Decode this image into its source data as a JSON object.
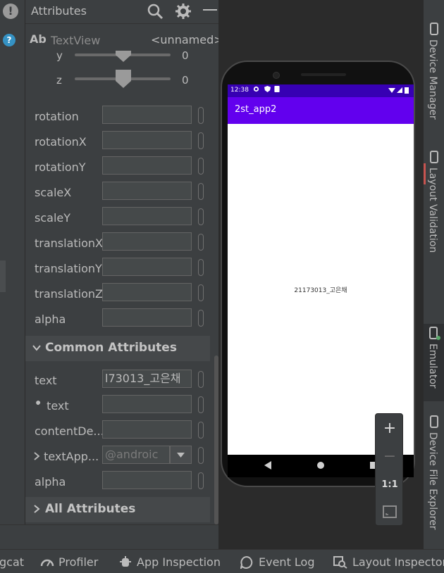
{
  "panel": {
    "title": "Attributes",
    "component": {
      "ab": "Ab",
      "type": "TextView",
      "name": "<unnamed>"
    }
  },
  "sliders": [
    {
      "label": "y",
      "value": "0",
      "level": 0.5
    },
    {
      "label": "z",
      "value": "0",
      "level": 0.5
    }
  ],
  "transform_attrs": [
    {
      "label": "rotation",
      "value": ""
    },
    {
      "label": "rotationX",
      "value": ""
    },
    {
      "label": "rotationY",
      "value": ""
    },
    {
      "label": "scaleX",
      "value": ""
    },
    {
      "label": "scaleY",
      "value": ""
    },
    {
      "label": "translationX",
      "value": ""
    },
    {
      "label": "translationY",
      "value": ""
    },
    {
      "label": "translationZ",
      "value": ""
    },
    {
      "label": "alpha",
      "value": ""
    }
  ],
  "common": {
    "title": "Common Attributes",
    "rows": {
      "text_label": "text",
      "text_value": "l73013_고은채",
      "tools_text_label": "text",
      "tools_text_value": "",
      "content_desc_label": "contentDe...",
      "content_desc_value": "",
      "text_appearance_label": "textApp...",
      "text_appearance_placeholder": "@androic",
      "alpha_label": "alpha",
      "alpha_value": ""
    }
  },
  "all_attributes": {
    "title": "All Attributes"
  },
  "device": {
    "status_time": "12:38",
    "app_title": "2st_app2",
    "center_text": "21173013_고은채"
  },
  "zoom": {
    "in": "+",
    "out": "−",
    "actual": "1:1"
  },
  "right_tabs": {
    "device_manager": "Device Manager",
    "layout_validation": "Layout Validation",
    "emulator": "Emulator",
    "device_file_explorer": "Device File Explorer"
  },
  "bottom_tabs": {
    "logcat": "gcat",
    "profiler": "Profiler",
    "app_inspection": "App Inspection",
    "event_log": "Event Log",
    "layout_inspector": "Layout Inspector"
  },
  "colors": {
    "app_bar": "#6200ee",
    "status_bar": "#3700b3",
    "panel_bg": "#3c3f41",
    "editor_bg": "#2b2b2b"
  }
}
